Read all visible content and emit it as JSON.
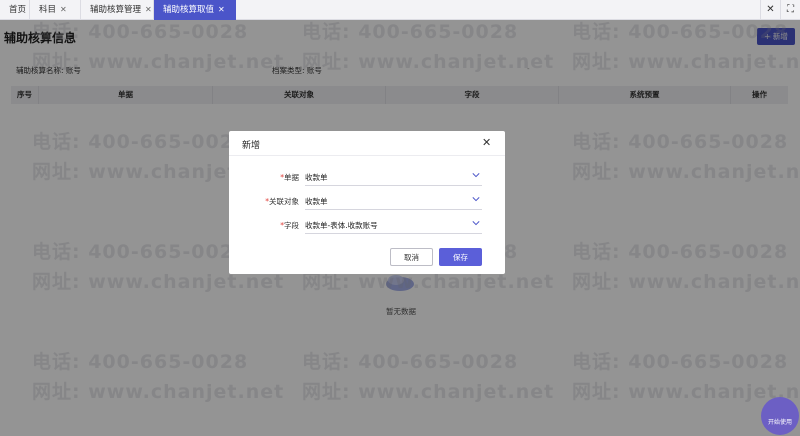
{
  "tabs": [
    {
      "label": "首页",
      "closable": false,
      "active": false
    },
    {
      "label": "科目",
      "closable": true,
      "active": false
    },
    {
      "label": "辅助核算管理",
      "closable": true,
      "active": false
    },
    {
      "label": "辅助核算取值",
      "closable": true,
      "active": true
    }
  ],
  "toolbar": {
    "close_glyph": "✕",
    "fullscreen_glyph": "⛶"
  },
  "page": {
    "title": "辅助核算信息",
    "add_button": "+ 新增",
    "info_left": "辅助核算名称: 账号",
    "info_right": "档案类型: 账号",
    "info_dot": "-"
  },
  "table": {
    "columns": [
      "序号",
      "单据",
      "关联对象",
      "字段",
      "系统预置",
      "操作"
    ],
    "empty_text": "暂无数据"
  },
  "watermark": {
    "phone": "电话: 400-665-0028",
    "site": "网址: www.chanjet.net"
  },
  "dialog": {
    "title": "新增",
    "fields": [
      {
        "label": "单据",
        "value": "收款单",
        "required": true
      },
      {
        "label": "关联对象",
        "value": "收款单",
        "required": true
      },
      {
        "label": "字段",
        "value": "收款单-表体.收款账号",
        "required": true
      }
    ],
    "cancel": "取消",
    "save": "保存"
  },
  "fab": {
    "label": "开始使用"
  },
  "colors": {
    "accent": "#4b55c9",
    "primary_button": "#5b5fd9",
    "required": "#e0403a"
  }
}
